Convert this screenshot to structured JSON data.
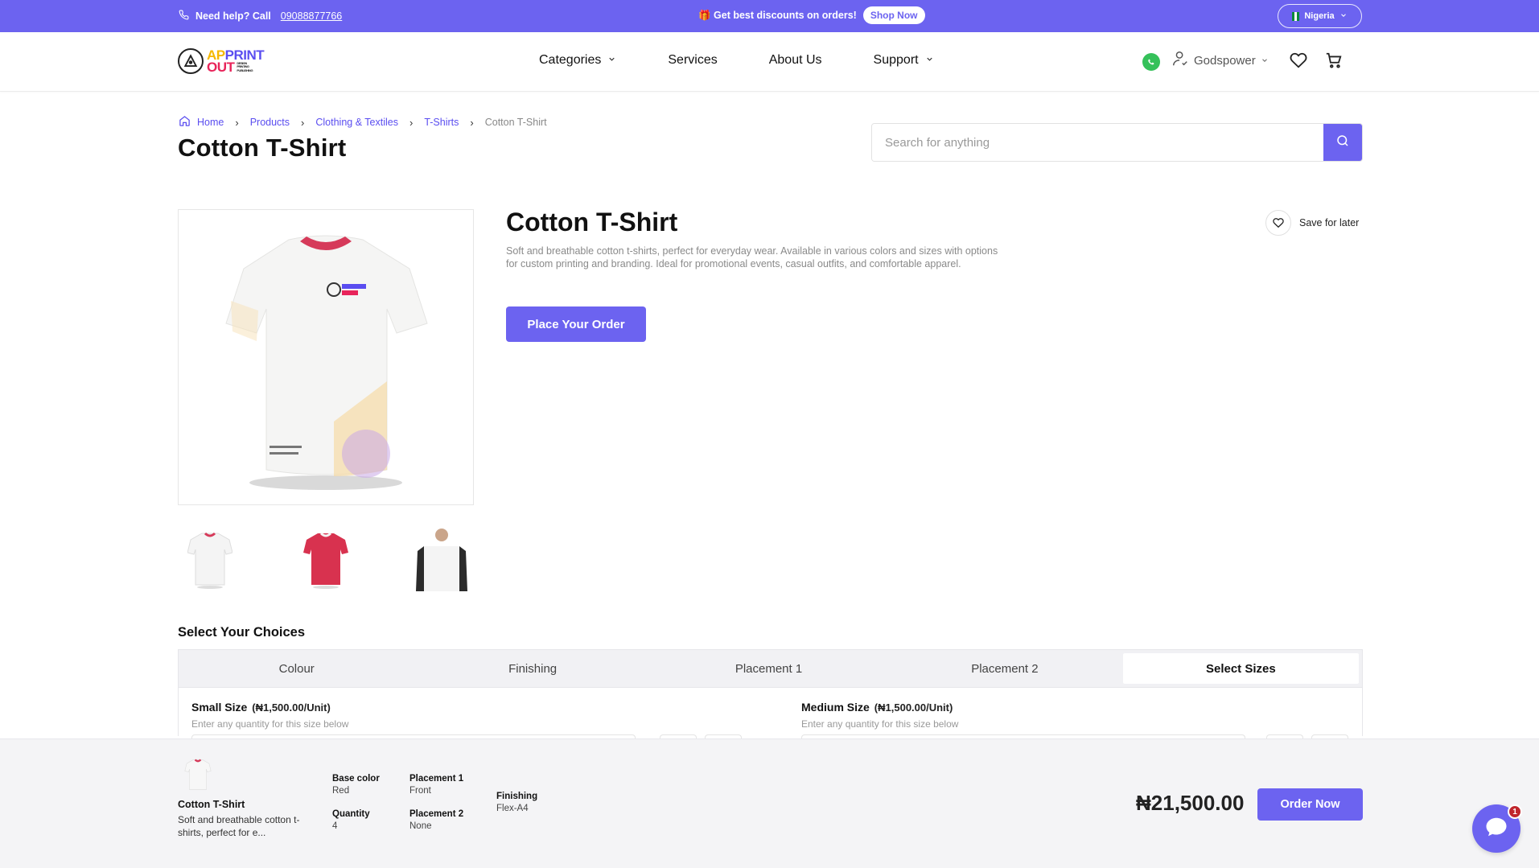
{
  "topbar": {
    "help_label": "Need help? Call",
    "help_phone": "09088877766",
    "promo_text": "🎁 Get best discounts on orders!",
    "shop_now": "Shop Now",
    "region": "Nigeria"
  },
  "header": {
    "logo": {
      "line1_a": "AP",
      "line1_b": "PRINT",
      "line2": "OUT",
      "tagline": [
        "DESIGN",
        "PRINTING",
        "PUBLISHING"
      ]
    },
    "nav": [
      "Categories",
      "Services",
      "About Us",
      "Support"
    ],
    "user_name": "Godspower"
  },
  "breadcrumb": [
    "Home",
    "Products",
    "Clothing & Textiles",
    "T-Shirts",
    "Cotton T-Shirt"
  ],
  "page_title": "Cotton T-Shirt",
  "search": {
    "placeholder": "Search for anything"
  },
  "product": {
    "title": "Cotton T-Shirt",
    "description": "Soft and breathable cotton t-shirts, perfect for everyday wear. Available in various colors and sizes with options for custom printing and branding. Ideal for promotional events, casual outfits, and comfortable apparel.",
    "place_order": "Place Your Order",
    "save_later": "Save for later"
  },
  "choices": {
    "title": "Select Your Choices",
    "tabs": [
      "Colour",
      "Finishing",
      "Placement 1",
      "Placement 2",
      "Select Sizes"
    ],
    "active_tab": "Select Sizes",
    "sizes": [
      {
        "name": "Small Size",
        "price": "(₦1,500.00/Unit)",
        "hint": "Enter any quantity for this size below"
      },
      {
        "name": "Medium Size",
        "price": "(₦1,500.00/Unit)",
        "hint": "Enter any quantity for this size below"
      }
    ]
  },
  "summary": {
    "name": "Cotton T-Shirt",
    "desc": "Soft and breathable cotton t-shirts, perfect for e...",
    "specs": {
      "base_color": {
        "label": "Base color",
        "value": "Red"
      },
      "quantity": {
        "label": "Quantity",
        "value": "4"
      },
      "placement1": {
        "label": "Placement 1",
        "value": "Front"
      },
      "placement2": {
        "label": "Placement 2",
        "value": "None"
      },
      "finishing": {
        "label": "Finishing",
        "value": "Flex-A4"
      }
    },
    "total": "₦21,500.00",
    "order_now": "Order Now"
  },
  "chat": {
    "badge": "1"
  },
  "colors": {
    "accent": "#6c63f0",
    "whatsapp": "#35c15a",
    "badge": "#c0262d"
  }
}
